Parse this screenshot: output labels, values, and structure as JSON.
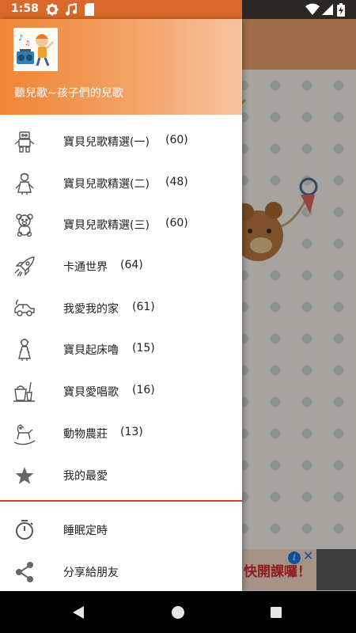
{
  "status_bar": {
    "time": "1:58"
  },
  "drawer": {
    "app_title": "聽兒歌~孩子們的兒歌",
    "items": [
      {
        "label": "寶貝兒歌精選(一)",
        "count": "(60)",
        "icon": "robot-icon"
      },
      {
        "label": "寶貝兒歌精選(二)",
        "count": "(48)",
        "icon": "doll-icon"
      },
      {
        "label": "寶貝兒歌精選(三)",
        "count": "(60)",
        "icon": "teddy-bear-icon"
      },
      {
        "label": "卡通世界",
        "count": "(64)",
        "icon": "rocket-icon"
      },
      {
        "label": "我愛我的家",
        "count": "(61)",
        "icon": "toy-car-icon"
      },
      {
        "label": "寶貝起床嚕",
        "count": "(15)",
        "icon": "girl-icon"
      },
      {
        "label": "寶貝愛唱歌",
        "count": "(16)",
        "icon": "sand-bucket-icon"
      },
      {
        "label": "動物農莊",
        "count": "(13)",
        "icon": "rocking-horse-icon"
      },
      {
        "label": "我的最愛",
        "count": "",
        "icon": "star-icon"
      }
    ],
    "secondary_items": [
      {
        "label": "睡眠定時",
        "icon": "timer-icon"
      },
      {
        "label": "分享給朋友",
        "icon": "share-icon"
      }
    ]
  },
  "ad": {
    "text": "快開課囉！"
  },
  "colors": {
    "accent": "#f08534",
    "divider": "#d83a3a"
  }
}
